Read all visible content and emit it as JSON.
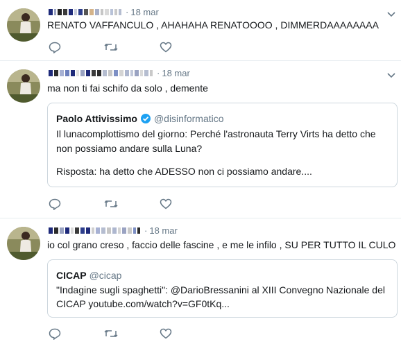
{
  "tweets": [
    {
      "time": "18 mar",
      "text": "RENATO VAFFANCULO , AHAHAHA RENATOOOO , DIMMERDAAAAAAAA"
    },
    {
      "time": "18 mar",
      "text": "ma non ti fai schifo da solo , demente",
      "quote": {
        "name": "Paolo Attivissimo",
        "handle": "@disinformatico",
        "line1": "Il lunacomplottismo del giorno: Perché l'astronauta Terry Virts ha detto che",
        "line2": "non possiamo andare sulla Luna?",
        "line3": "Risposta: ha detto che ADESSO non ci possiamo andare...."
      }
    },
    {
      "time": "18 mar",
      "text": "io col grano creso , faccio delle fascine , e me le infilo , SU PER TUTTO IL CULO",
      "quote": {
        "name": "CICAP",
        "handle": "@cicap",
        "line1": "\"Indagine sugli spaghetti\": @DarioBressanini al XIII Convegno Nazionale del",
        "line2": "CICAP youtube.com/watch?v=GF0tKq..."
      }
    }
  ],
  "separator": "·",
  "icons": [
    "reply-icon",
    "retweet-icon",
    "like-icon",
    "caret-down-icon",
    "verified-badge-icon"
  ],
  "colors": {
    "text": "#14171a",
    "muted": "#657786",
    "border": "#e6ecf0",
    "verified": "#1da1f2"
  }
}
